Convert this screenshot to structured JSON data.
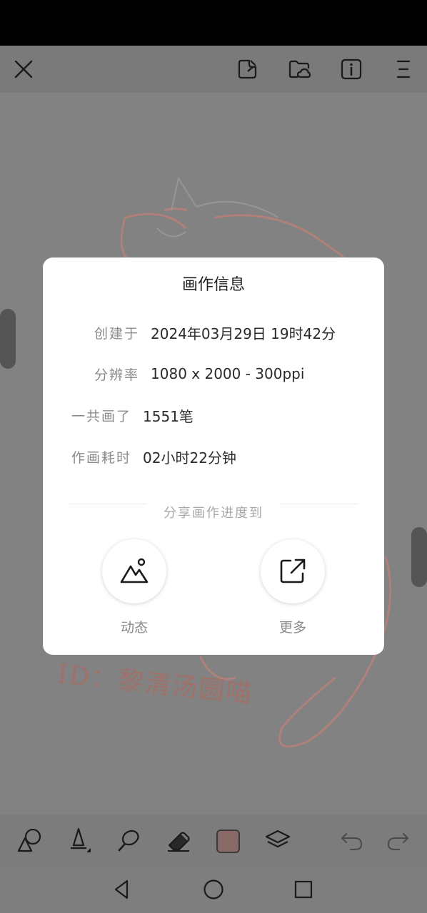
{
  "dialog": {
    "title": "画作信息",
    "rows": [
      {
        "label": "创建于",
        "value": "2024年03月29日 19时42分"
      },
      {
        "label": "分辨率",
        "value": "1080 x 2000 - 300ppi"
      },
      {
        "label": "一共画了",
        "value": "1551笔"
      },
      {
        "label": "作画耗时",
        "value": "02小时22分钟"
      }
    ],
    "share_title": "分享画作进度到",
    "share_options": [
      {
        "label": "动态",
        "icon": "image-icon"
      },
      {
        "label": "更多",
        "icon": "external-link-icon"
      }
    ]
  },
  "top_toolbar": {
    "icons": [
      "close-icon",
      "sticker-icon",
      "cloud-folder-icon",
      "info-icon",
      "menu-icon"
    ]
  },
  "bottom_toolbar": {
    "icons": [
      "shapes-icon",
      "pen-icon",
      "smudge-icon",
      "eraser-icon",
      "color-swatch",
      "layers-icon",
      "undo-icon",
      "redo-icon"
    ],
    "current_color": "#8a6a66"
  },
  "canvas": {
    "watermark": "ID：黎清汤圆喵"
  },
  "nav_bar": {
    "icons": [
      "back-icon",
      "home-icon",
      "recents-icon"
    ]
  },
  "colors": {
    "overlay": "#808080",
    "sketch_line": "#c98c82"
  }
}
